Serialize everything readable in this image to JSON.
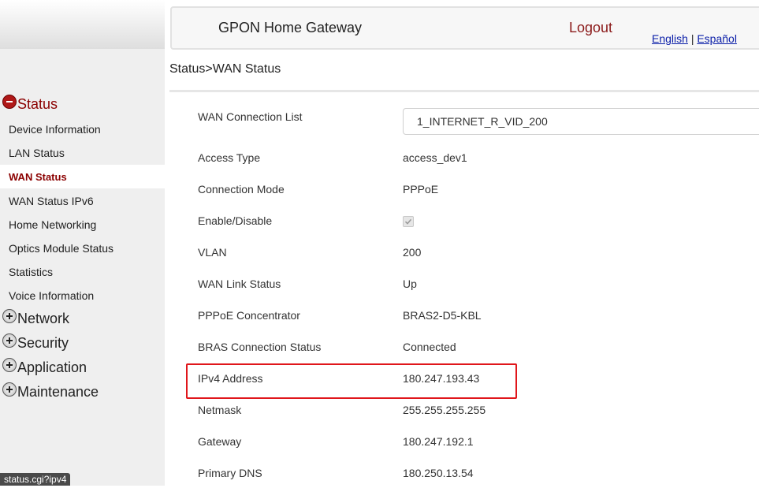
{
  "header": {
    "title": "GPON Home Gateway",
    "logout_label": "Logout",
    "lang_english": "English",
    "lang_separator": "|",
    "lang_espanol": "Español"
  },
  "breadcrumb": "Status>WAN Status",
  "sidebar": {
    "status_group": "Status",
    "status_items": [
      {
        "label": "Device Information"
      },
      {
        "label": "LAN Status"
      },
      {
        "label": "WAN Status",
        "active": true
      },
      {
        "label": "WAN Status IPv6"
      },
      {
        "label": "Home Networking"
      },
      {
        "label": "Optics Module Status"
      },
      {
        "label": "Statistics"
      },
      {
        "label": "Voice Information"
      }
    ],
    "other_groups": [
      "Network",
      "Security",
      "Application",
      "Maintenance"
    ]
  },
  "status_bar_url": "status.cgi?ipv4",
  "wan": {
    "connection_list_label": "WAN Connection List",
    "connection_list_value": "1_INTERNET_R_VID_200",
    "rows": [
      {
        "label": "Access Type",
        "value": "access_dev1"
      },
      {
        "label": "Connection Mode",
        "value": "PPPoE"
      },
      {
        "label": "Enable/Disable",
        "value": ""
      },
      {
        "label": "VLAN",
        "value": "200"
      },
      {
        "label": "WAN Link Status",
        "value": "Up"
      },
      {
        "label": "PPPoE Concentrator",
        "value": "BRAS2-D5-KBL"
      },
      {
        "label": "BRAS Connection Status",
        "value": "Connected"
      },
      {
        "label": "IPv4 Address",
        "value": "180.247.193.43"
      },
      {
        "label": "Netmask",
        "value": "255.255.255.255"
      },
      {
        "label": "Gateway",
        "value": "180.247.192.1"
      },
      {
        "label": "Primary DNS",
        "value": "180.250.13.54"
      }
    ],
    "enable_checked": true
  },
  "colors": {
    "accent": "#8b0000",
    "highlight": "#e0161b",
    "link": "#0a1ea8"
  }
}
